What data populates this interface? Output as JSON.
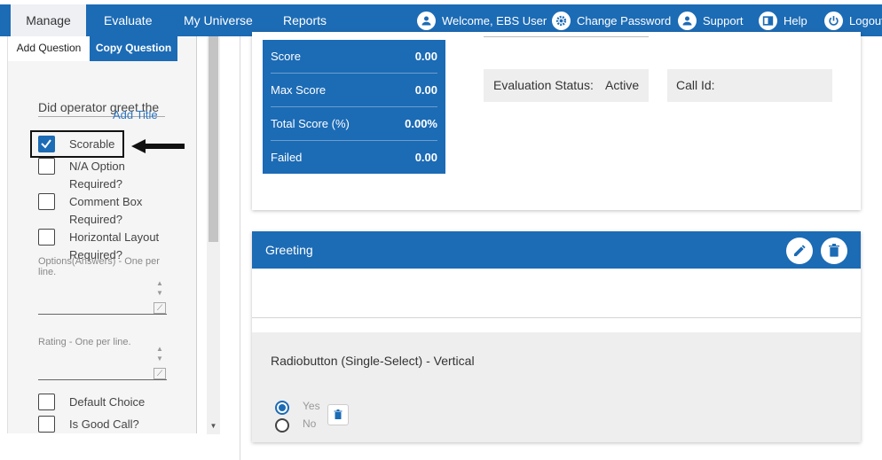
{
  "nav": {
    "tabs": [
      {
        "label": "Manage",
        "active": true
      },
      {
        "label": "Evaluate"
      },
      {
        "label": "My Universe"
      },
      {
        "label": "Reports"
      }
    ],
    "user": {
      "label": "Welcome, EBS User",
      "icon": "account-circle-icon"
    },
    "change_password": {
      "label": "Change Password",
      "icon": "gear-icon"
    },
    "support": {
      "label": "Support",
      "icon": "account-circle-icon"
    },
    "help": {
      "label": "Help",
      "icon": "book-icon"
    },
    "logout": {
      "label": "Logout",
      "icon": "power-icon"
    },
    "colors": {
      "bar": "#1c6bb5",
      "active_tab": "#eef0f4"
    }
  },
  "left_panel": {
    "tabs": {
      "add_question": "Add Question",
      "copy_question": "Copy Question"
    },
    "question_text": "Did operator greet the",
    "add_title_link": "Add Title",
    "checkboxes": [
      {
        "label": "Scorable",
        "checked": true
      },
      {
        "label": "N/A Option Required?",
        "checked": false
      },
      {
        "label": "Comment Box Required?",
        "checked": false
      },
      {
        "label": "Horizontal Layout Required?",
        "checked": false
      }
    ],
    "options_label": "Options(Answers) - One per line.",
    "rating_label": "Rating - One per line.",
    "bottom_checkboxes": [
      {
        "label": "Default Choice",
        "checked": false
      },
      {
        "label": "Is Good Call?",
        "checked": false
      }
    ]
  },
  "score_card": {
    "rows": [
      {
        "label": "Score",
        "value": "0.00"
      },
      {
        "label": "Max Score",
        "value": "0.00"
      },
      {
        "label": "Total Score (%)",
        "value": "0.00%"
      },
      {
        "label": "Failed",
        "value": "0.00"
      }
    ],
    "evaluation_status_label": "Evaluation Status:",
    "evaluation_status_value": "Active",
    "call_id_label": "Call Id:"
  },
  "section": {
    "title": "Greeting",
    "edit_icon": "pencil-icon",
    "delete_icon": "trash-icon",
    "question_type": "Radiobutton (Single-Select) - Vertical",
    "options": [
      {
        "label": "Yes",
        "selected": true
      },
      {
        "label": "No",
        "selected": false
      }
    ]
  }
}
